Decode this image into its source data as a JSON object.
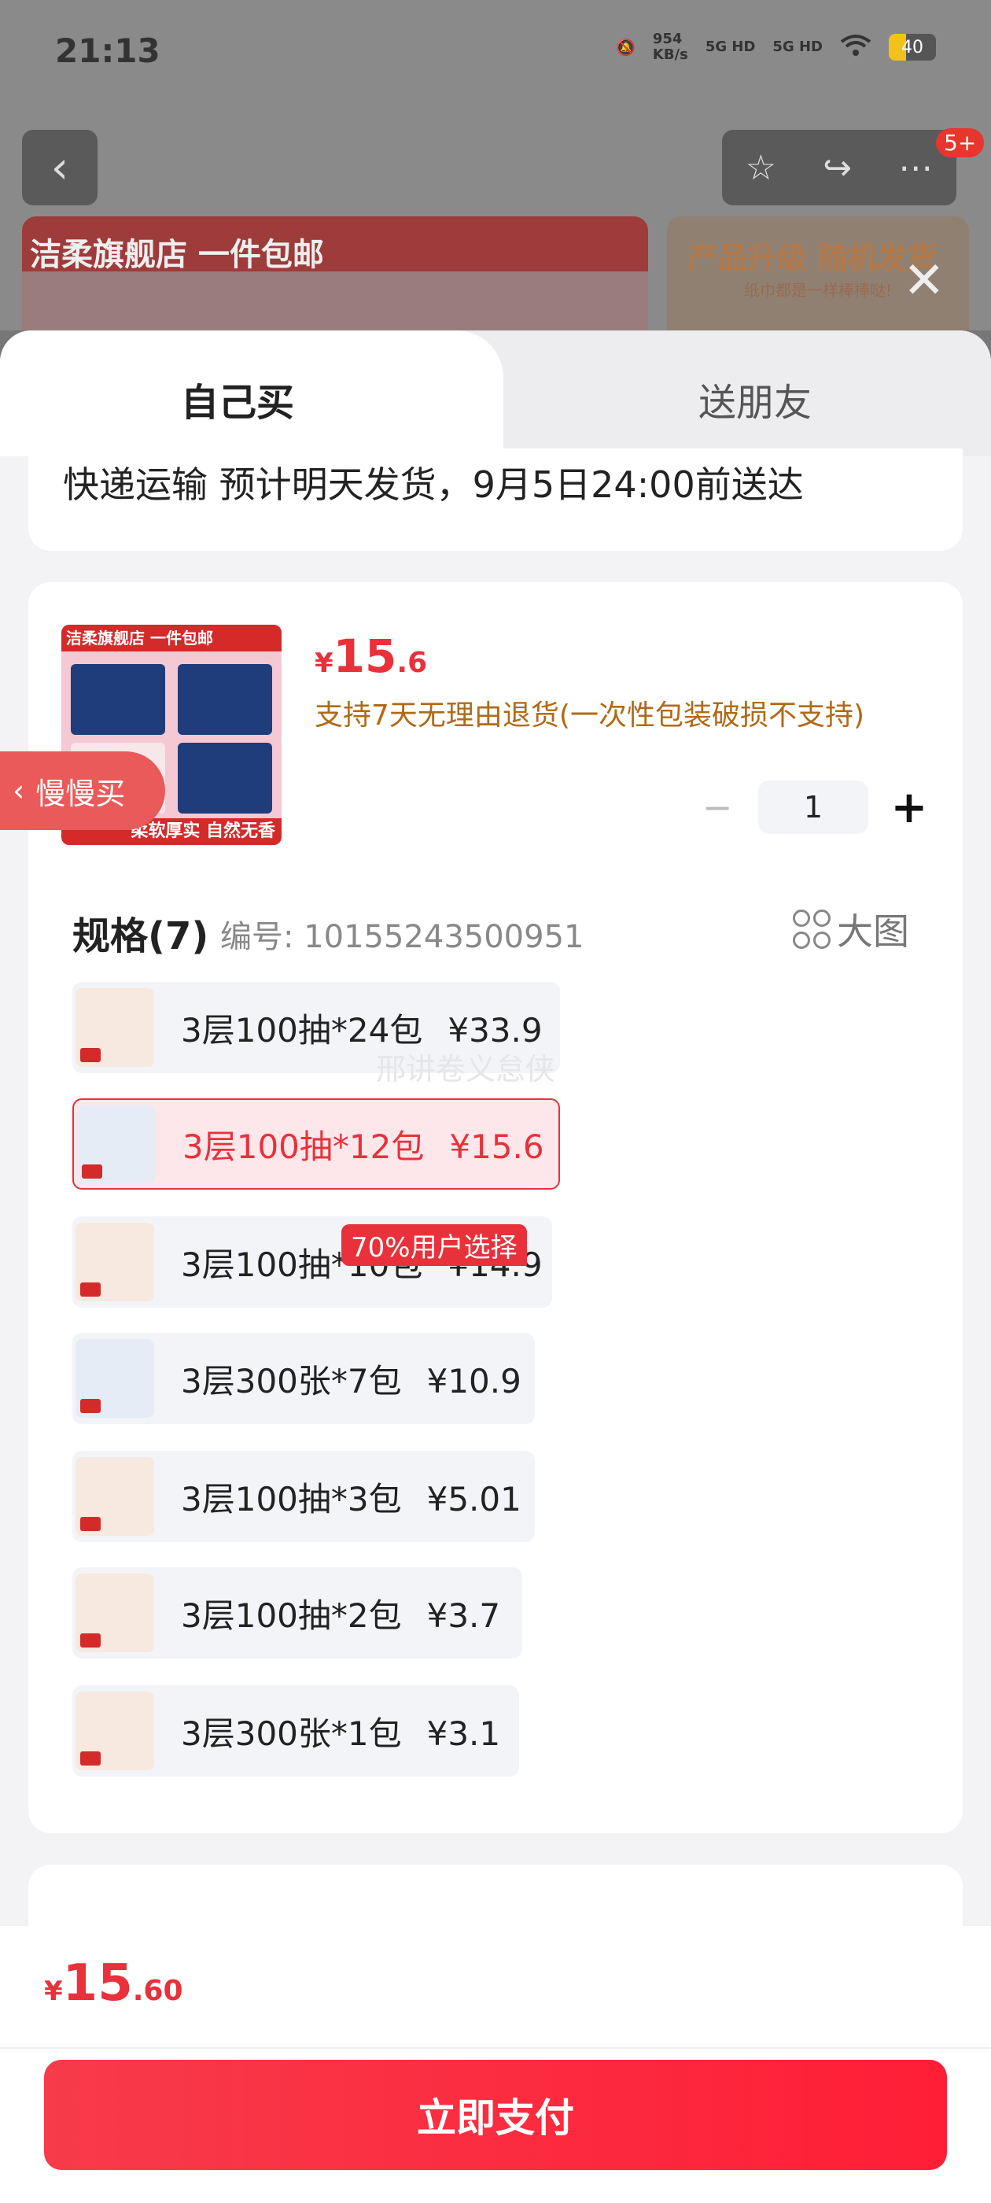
{
  "status_bar": {
    "time": "21:13",
    "net_speed_value": "954",
    "net_speed_unit": "KB/s",
    "sig1": "5G HD",
    "sig2": "5G HD",
    "battery": "40",
    "mute_icon": "bell-off-icon",
    "wifi_icon": "wifi-icon"
  },
  "top_bar": {
    "back_icon": "chevron-left-icon",
    "actions": [
      "star-icon",
      "share-icon",
      "more-icon"
    ],
    "badge": "5+"
  },
  "banners": {
    "left_title": "洁柔旗舰店 一件包邮",
    "right_title": "产品升级 随机发货",
    "right_subtitle": "纸巾都是一样棒棒哒!"
  },
  "tabs": {
    "self": "自己买",
    "friend": "送朋友"
  },
  "delivery": "快递运输 预计明天发货，9月5日24:00前送达",
  "product": {
    "image_top_text": "洁柔旗舰店 一件包邮",
    "image_bottom_text": "柔软厚实 自然无香",
    "price_symbol": "¥",
    "price_int": "15",
    "price_dec": ".6",
    "support": "支持7天无理由退货(一次性包装破损不支持)",
    "quantity": "1"
  },
  "spec": {
    "title": "规格(7)",
    "code": "编号: 10155243500951",
    "big_pic": "大图",
    "options": [
      {
        "name": "3层100抽*24包",
        "price": "¥33.9",
        "selected": false
      },
      {
        "name": "3层100抽*12包",
        "price": "¥15.6",
        "selected": true
      },
      {
        "name": "3层100抽*10包",
        "price": "¥14.9",
        "selected": false
      },
      {
        "name": "3层300张*7包",
        "price": "¥10.9",
        "selected": false
      },
      {
        "name": "3层100抽*3包",
        "price": "¥5.01",
        "selected": false
      },
      {
        "name": "3层100抽*2包",
        "price": "¥3.7",
        "selected": false
      },
      {
        "name": "3层300张*1包",
        "price": "¥3.1",
        "selected": false
      }
    ],
    "popular_tag": "70%用户选择",
    "watermark": "邢讲卷义怠侠"
  },
  "side_tab": "慢慢买",
  "footer": {
    "price_symbol": "¥",
    "price_int": "15",
    "price_dec": ".60",
    "pay_button": "立即支付"
  },
  "colors": {
    "accent": "#e8313a",
    "support_text": "#b06a16"
  }
}
